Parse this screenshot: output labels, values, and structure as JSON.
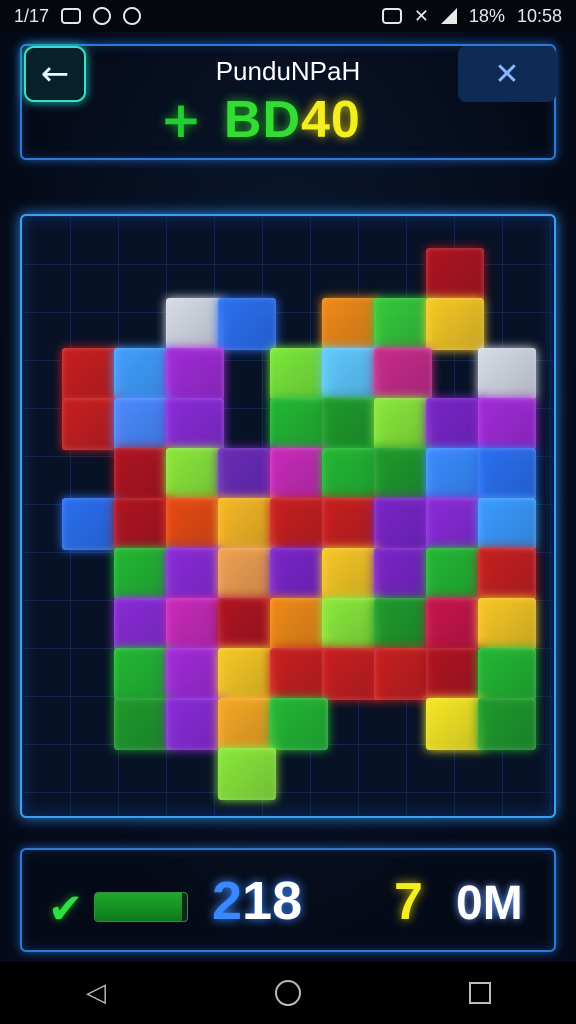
{
  "status_bar": {
    "left_text": "1/17",
    "battery": "18%",
    "time": "10:58"
  },
  "header": {
    "back_label": "←",
    "close_label": "✕",
    "title": "PunduNPaH",
    "plus_label": "+",
    "score_part1": "BD",
    "score_part2": "40"
  },
  "footer": {
    "check_label": "✔",
    "progress": 0.95,
    "moves_first": "2",
    "moves_rest": "18",
    "hint_label": "7",
    "hint_text": "0M"
  },
  "nav": {
    "back": "◁",
    "home": "○",
    "recent": "□"
  },
  "colors": {
    "accent": "#3aa0f0",
    "green": "#33dd33",
    "yellow": "#f2ee20"
  },
  "pieces": [
    {
      "r": 0,
      "c": 7,
      "color": "#b0131f"
    },
    {
      "r": 1,
      "c": 2,
      "color": "#d8dce6"
    },
    {
      "r": 1,
      "c": 3,
      "color": "#2b6ff0"
    },
    {
      "r": 1,
      "c": 5,
      "color": "#f08a16"
    },
    {
      "r": 1,
      "c": 6,
      "color": "#34c83a"
    },
    {
      "r": 1,
      "c": 7,
      "color": "#f6c823"
    },
    {
      "r": 2,
      "c": 0,
      "color": "#c81e1e"
    },
    {
      "r": 2,
      "c": 1,
      "color": "#3fa0ff"
    },
    {
      "r": 2,
      "c": 2,
      "color": "#a22ad8"
    },
    {
      "r": 2,
      "c": 4,
      "color": "#7ae83a"
    },
    {
      "r": 2,
      "c": 5,
      "color": "#5fc8ff"
    },
    {
      "r": 2,
      "c": 6,
      "color": "#c82a8a"
    },
    {
      "r": 2,
      "c": 8,
      "color": "#d8dce6"
    },
    {
      "r": 3,
      "c": 0,
      "color": "#c81e1e"
    },
    {
      "r": 3,
      "c": 1,
      "color": "#4a8aff"
    },
    {
      "r": 3,
      "c": 2,
      "color": "#8a2ad8"
    },
    {
      "r": 3,
      "c": 4,
      "color": "#22b832"
    },
    {
      "r": 3,
      "c": 5,
      "color": "#1f9a2a"
    },
    {
      "r": 3,
      "c": 6,
      "color": "#8ae83a"
    },
    {
      "r": 3,
      "c": 7,
      "color": "#7a24c8"
    },
    {
      "r": 3,
      "c": 8,
      "color": "#a22ad8"
    },
    {
      "r": 4,
      "c": 1,
      "color": "#b0131f"
    },
    {
      "r": 4,
      "c": 2,
      "color": "#8ae83a"
    },
    {
      "r": 4,
      "c": 3,
      "color": "#6a2ab8"
    },
    {
      "r": 4,
      "c": 4,
      "color": "#c82ab8"
    },
    {
      "r": 4,
      "c": 5,
      "color": "#22b832"
    },
    {
      "r": 4,
      "c": 6,
      "color": "#1f9a2a"
    },
    {
      "r": 4,
      "c": 7,
      "color": "#3a8cff"
    },
    {
      "r": 4,
      "c": 8,
      "color": "#2a6ff0"
    },
    {
      "r": 5,
      "c": 0,
      "color": "#2a6ff0"
    },
    {
      "r": 5,
      "c": 1,
      "color": "#b0131f"
    },
    {
      "r": 5,
      "c": 2,
      "color": "#e84a12"
    },
    {
      "r": 5,
      "c": 3,
      "color": "#f6b823"
    },
    {
      "r": 5,
      "c": 4,
      "color": "#c81e1e"
    },
    {
      "r": 5,
      "c": 5,
      "color": "#c81e1e"
    },
    {
      "r": 5,
      "c": 6,
      "color": "#7a24c8"
    },
    {
      "r": 5,
      "c": 7,
      "color": "#8a2ad8"
    },
    {
      "r": 5,
      "c": 8,
      "color": "#3a9cff"
    },
    {
      "r": 6,
      "c": 1,
      "color": "#22b832"
    },
    {
      "r": 6,
      "c": 2,
      "color": "#8a2ad8"
    },
    {
      "r": 6,
      "c": 3,
      "color": "#f0a050"
    },
    {
      "r": 6,
      "c": 4,
      "color": "#7a24c8"
    },
    {
      "r": 6,
      "c": 5,
      "color": "#f6c823"
    },
    {
      "r": 6,
      "c": 6,
      "color": "#7a24c8"
    },
    {
      "r": 6,
      "c": 7,
      "color": "#22b832"
    },
    {
      "r": 6,
      "c": 8,
      "color": "#c81e1e"
    },
    {
      "r": 7,
      "c": 1,
      "color": "#8a2ad8"
    },
    {
      "r": 7,
      "c": 2,
      "color": "#c82ab8"
    },
    {
      "r": 7,
      "c": 3,
      "color": "#b0131f"
    },
    {
      "r": 7,
      "c": 4,
      "color": "#f08a16"
    },
    {
      "r": 7,
      "c": 5,
      "color": "#8ae83a"
    },
    {
      "r": 7,
      "c": 6,
      "color": "#1f9a2a"
    },
    {
      "r": 7,
      "c": 7,
      "color": "#c8134a"
    },
    {
      "r": 7,
      "c": 8,
      "color": "#f6c823"
    },
    {
      "r": 8,
      "c": 1,
      "color": "#22b832"
    },
    {
      "r": 8,
      "c": 2,
      "color": "#a22ad8"
    },
    {
      "r": 8,
      "c": 3,
      "color": "#f6c823"
    },
    {
      "r": 8,
      "c": 4,
      "color": "#c81e1e"
    },
    {
      "r": 8,
      "c": 5,
      "color": "#c81e1e"
    },
    {
      "r": 8,
      "c": 6,
      "color": "#c81e1e"
    },
    {
      "r": 8,
      "c": 7,
      "color": "#b0131f"
    },
    {
      "r": 8,
      "c": 8,
      "color": "#22b832"
    },
    {
      "r": 9,
      "c": 1,
      "color": "#1f9a2a"
    },
    {
      "r": 9,
      "c": 2,
      "color": "#8a2ad8"
    },
    {
      "r": 9,
      "c": 3,
      "color": "#f6a823"
    },
    {
      "r": 9,
      "c": 4,
      "color": "#22b832"
    },
    {
      "r": 9,
      "c": 7,
      "color": "#f6e823"
    },
    {
      "r": 9,
      "c": 8,
      "color": "#1f9a2a"
    },
    {
      "r": 10,
      "c": 3,
      "color": "#8ae83a"
    }
  ]
}
